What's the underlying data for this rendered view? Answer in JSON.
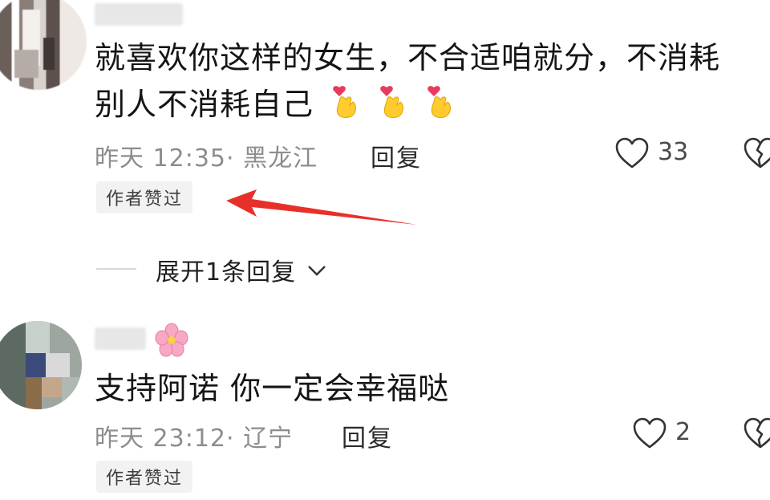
{
  "comments": [
    {
      "text_line1": "就喜欢你这样的女生，不合适咱就分，不消耗",
      "text_line2": "别人不消耗自己",
      "emoji": [
        "finger-heart-emoji",
        "finger-heart-emoji",
        "finger-heart-emoji"
      ],
      "time": "昨天 12:35",
      "location": "· 黑龙江",
      "reply_label": "回复",
      "likes": "33",
      "badge": "作者赞过"
    },
    {
      "text_line1": "支持阿诺 你一定会幸福哒",
      "time": "昨天 23:12",
      "location": "· 辽宁",
      "reply_label": "回复",
      "likes": "2",
      "badge": "作者赞过",
      "name_emoji": "cherry-blossom-emoji"
    }
  ],
  "expand_replies": "展开1条回复",
  "colors": {
    "arrow": "#e8302a",
    "meta": "#8d8d8d",
    "badge_bg": "#f2f2f2"
  }
}
